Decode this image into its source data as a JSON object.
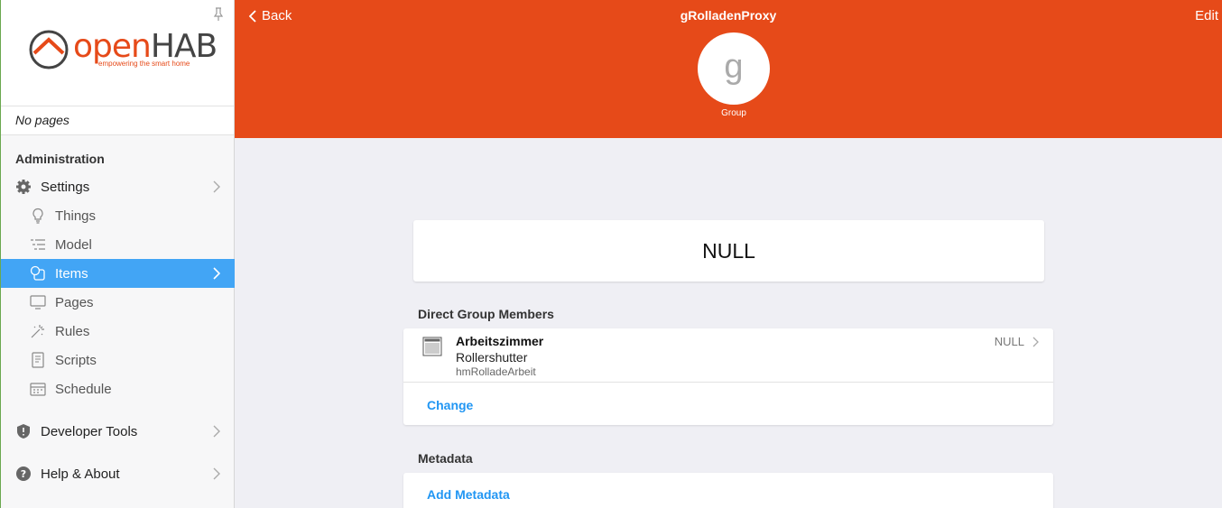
{
  "sidebar": {
    "logo": {
      "open": "open",
      "hab": "HAB",
      "tagline": "empowering the smart home"
    },
    "no_pages": "No pages",
    "section_title": "Administration",
    "settings": "Settings",
    "things": "Things",
    "model": "Model",
    "items": "Items",
    "pages": "Pages",
    "rules": "Rules",
    "scripts": "Scripts",
    "schedule": "Schedule",
    "developer_tools": "Developer Tools",
    "help_about": "Help & About"
  },
  "header": {
    "back": "Back",
    "title": "gRolladenProxy",
    "edit": "Edit",
    "avatar_letter": "g",
    "avatar_label": "Group"
  },
  "state": "NULL",
  "members_section": {
    "title": "Direct Group Members",
    "member": {
      "name": "Arbeitszimmer",
      "type": "Rollershutter",
      "id": "hmRolladeArbeit",
      "state": "NULL"
    },
    "change": "Change"
  },
  "metadata_section": {
    "title": "Metadata",
    "add": "Add Metadata"
  },
  "colors": {
    "accent": "#e64a19",
    "active": "#42a5f5",
    "link": "#2196f3"
  }
}
